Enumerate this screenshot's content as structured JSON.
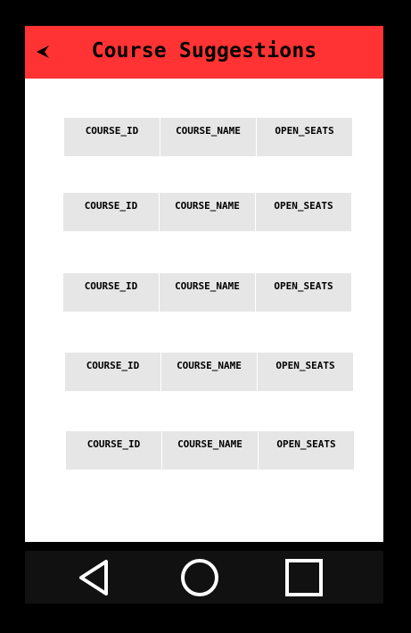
{
  "app_bar": {
    "title": "Course Suggestions",
    "back_icon": "back-arrow-icon",
    "color": "#ff3333"
  },
  "table_rows": [
    {
      "col1": "COURSE_ID",
      "col2": "COURSE_NAME",
      "col3": "OPEN_SEATS"
    },
    {
      "col1": "COURSE_ID",
      "col2": "COURSE_NAME",
      "col3": "OPEN_SEATS"
    },
    {
      "col1": "COURSE_ID",
      "col2": "COURSE_NAME",
      "col3": "OPEN_SEATS"
    },
    {
      "col1": "COURSE_ID",
      "col2": "COURSE_NAME",
      "col3": "OPEN_SEATS"
    },
    {
      "col1": "COURSE_ID",
      "col2": "COURSE_NAME",
      "col3": "OPEN_SEATS"
    }
  ],
  "nav_bar": {
    "back_icon": "nav-back-triangle-icon",
    "home_icon": "nav-home-circle-icon",
    "recents_icon": "nav-recents-square-icon"
  },
  "colors": {
    "cell_background": "#e6e6e6",
    "screen_background": "#ffffff",
    "frame": "#000000",
    "nav_background": "#111111"
  }
}
